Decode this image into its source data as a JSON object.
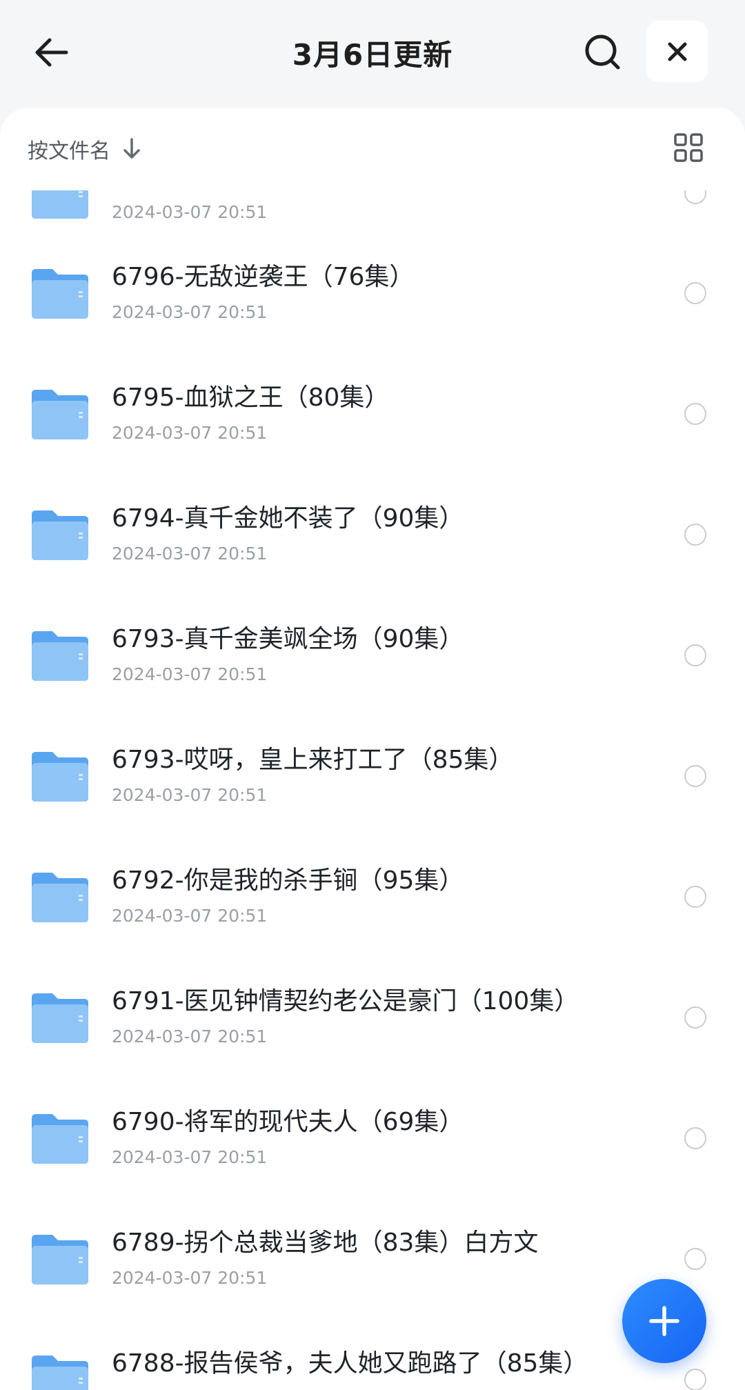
{
  "header": {
    "title": "3月6日更新",
    "back_icon": "arrow-left-icon",
    "search_icon": "search-icon",
    "close_icon": "close-icon"
  },
  "sort_bar": {
    "label": "按文件名",
    "direction_icon": "arrow-down-icon",
    "view_icon": "grid-view-icon"
  },
  "colors": {
    "accent": "#1a73ff",
    "folder": "#7ab8f5",
    "text_primary": "#1f2329",
    "text_secondary": "#9a9fa6"
  },
  "files": [
    {
      "name": "",
      "date": "2024-03-07 20:51"
    },
    {
      "name": "6796-无敌逆袭王（76集）",
      "date": "2024-03-07 20:51"
    },
    {
      "name": "6795-血狱之王（80集）",
      "date": "2024-03-07 20:51"
    },
    {
      "name": "6794-真千金她不装了（90集）",
      "date": "2024-03-07 20:51"
    },
    {
      "name": "6793-真千金美飒全场（90集）",
      "date": "2024-03-07 20:51"
    },
    {
      "name": "6793-哎呀，皇上来打工了（85集）",
      "date": "2024-03-07 20:51"
    },
    {
      "name": "6792-你是我的杀手锏（95集）",
      "date": "2024-03-07 20:51"
    },
    {
      "name": "6791-医见钟情契约老公是豪门（100集）",
      "date": "2024-03-07 20:51"
    },
    {
      "name": "6790-将军的现代夫人（69集）",
      "date": "2024-03-07 20:51"
    },
    {
      "name": "6789-拐个总裁当爹地（83集）白方文",
      "date": "2024-03-07 20:51"
    },
    {
      "name": "6788-报告侯爷，夫人她又跑路了（85集）",
      "date": ""
    }
  ],
  "fab": {
    "icon": "plus-icon"
  }
}
